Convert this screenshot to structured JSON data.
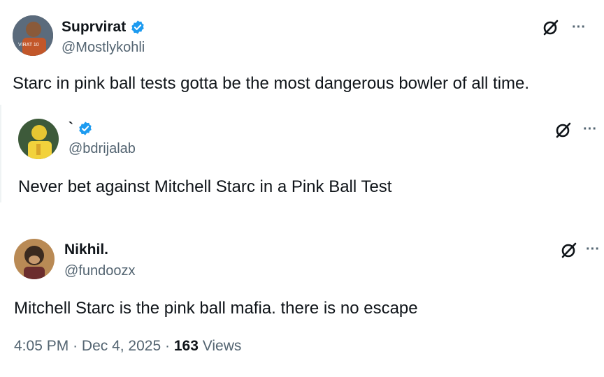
{
  "main_post": {
    "name": "Suprvirat",
    "handle": "@Mostlykohli",
    "text": "Starc in pink ball tests gotta be the most dangerous bowler of all time.",
    "avatar_text": "VIRAT 10"
  },
  "quoted_post": {
    "name": "`",
    "handle": "@bdrijalab",
    "text": "Never bet against Mitchell Starc in a Pink Ball Test"
  },
  "reply_post": {
    "name": "Nikhil.",
    "handle": "@fundoozx",
    "text": "Mitchell Starc is the pink ball mafia.  there is no escape"
  },
  "meta": {
    "time": "4:05 PM",
    "separator": "·",
    "date": "Dec 4, 2025",
    "views_count": "163",
    "views_label": "Views"
  },
  "icons": [
    "verified-badge-icon",
    "grok-icon",
    "more-options-icon"
  ],
  "colors": {
    "verified": "#1d9bf0",
    "secondary_text": "#536471",
    "primary_text": "#0f1419"
  }
}
